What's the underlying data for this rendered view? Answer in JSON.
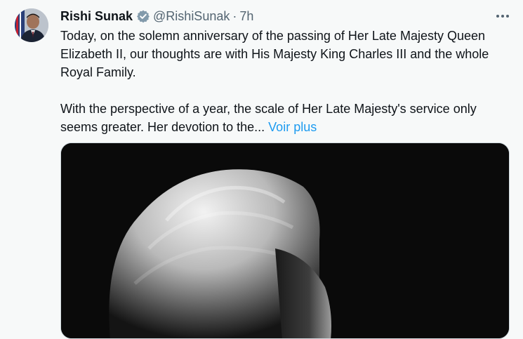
{
  "author": {
    "name": "Rishi Sunak",
    "handle": "@RishiSunak",
    "separator": "·",
    "time": "7h",
    "verified_icon": "verified-badge-icon",
    "verified_color": "#829aab"
  },
  "tweet": {
    "paragraph1": "Today, on the solemn anniversary of the passing of Her Late Majesty Queen Elizabeth II, our thoughts are with His Majesty King Charles III and the whole Royal Family.",
    "paragraph2": "With the perspective of a year, the scale of Her Late Majesty's service only seems greater. Her devotion to the...",
    "show_more": "Voir plus"
  },
  "menu": {
    "icon": "more-horizontal-icon"
  },
  "colors": {
    "background": "#f7f9f9",
    "text": "#0f1419",
    "secondary": "#536471",
    "link": "#1d9bf0"
  }
}
